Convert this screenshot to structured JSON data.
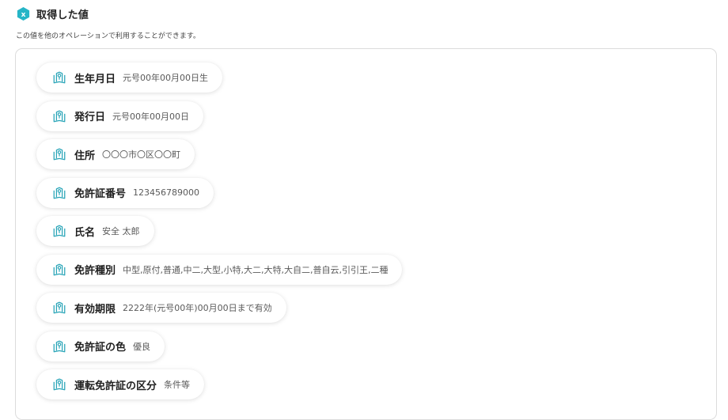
{
  "header": {
    "badge_icon": "x-variable-badge-icon",
    "badge_color": "#26b5c7",
    "title": "取得した値"
  },
  "description": "この値を他のオペレーションで利用することができます。",
  "fields": [
    {
      "label": "生年月日",
      "value": "元号00年00月00日生",
      "icon": "book-variable-icon"
    },
    {
      "label": "発行日",
      "value": "元号00年00月00日",
      "icon": "book-variable-icon"
    },
    {
      "label": "住所",
      "value": "〇〇〇市〇区〇〇町",
      "icon": "book-variable-icon"
    },
    {
      "label": "免許証番号",
      "value": "123456789000",
      "icon": "book-variable-icon"
    },
    {
      "label": "氏名",
      "value": "安全 太郎",
      "icon": "book-variable-icon"
    },
    {
      "label": "免許種別",
      "value": "中型,原付,普通,中二,大型,小特,大二,大特,大自二,普自云,引引王,二種",
      "icon": "book-variable-icon"
    },
    {
      "label": "有効期限",
      "value": "2222年(元号00年)00月00日まで有効",
      "icon": "book-variable-icon"
    },
    {
      "label": "免許証の色",
      "value": "優良",
      "icon": "book-variable-icon"
    },
    {
      "label": "運転免許証の区分",
      "value": "条件等",
      "icon": "book-variable-icon"
    }
  ],
  "colors": {
    "icon_stroke": "#2aa5b8",
    "label_text": "#1f1f1f",
    "value_text": "#5a5a5a"
  }
}
